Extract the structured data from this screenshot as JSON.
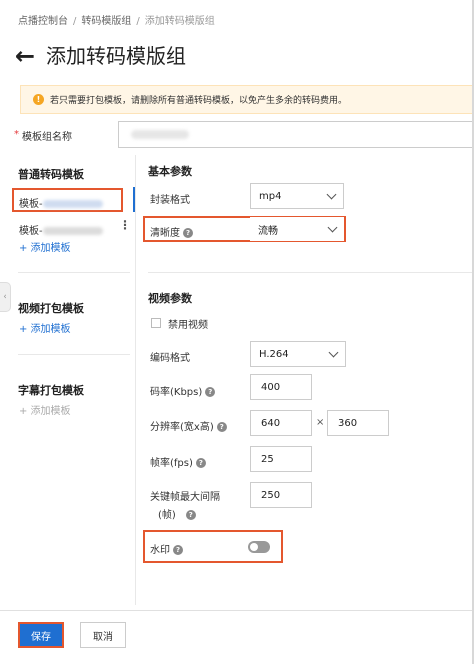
{
  "breadcrumb": [
    "点播控制台",
    "转码模版组",
    "添加转码模版组"
  ],
  "page_title": "添加转码模版组",
  "notice": "若只需要打包模板，请删除所有普通转码模板，以免产生多余的转码费用。",
  "name_field": {
    "label": "模板组名称",
    "value": ""
  },
  "left": {
    "normal_section": "普通转码模板",
    "item1_prefix": "模板-",
    "item2_prefix": "模板-",
    "add_label": "+ 添加模板",
    "video_pack_section": "视频打包模板",
    "video_add_label": "+ 添加模板",
    "subtitle_section": "字幕打包模板",
    "subtitle_add_label": "+ 添加模板"
  },
  "basic": {
    "title": "基本参数",
    "container_label": "封装格式",
    "container_value": "mp4",
    "quality_label": "清晰度",
    "quality_value": "流畅"
  },
  "video": {
    "title": "视频参数",
    "disable_label": "禁用视频",
    "codec_label": "编码格式",
    "codec_value": "H.264",
    "bitrate_label": "码率(Kbps)",
    "bitrate_value": "400",
    "resolution_label": "分辨率(宽x高)",
    "width_value": "640",
    "times": "×",
    "height_value": "360",
    "fps_label": "帧率(fps)",
    "fps_value": "25",
    "gop_label_line1": "关键帧最大间隔",
    "gop_label_line2": "(帧)",
    "gop_value": "250",
    "watermark_label": "水印",
    "watermark_on": false
  },
  "footer": {
    "save": "保存",
    "cancel": "取消"
  },
  "colors": {
    "primary": "#1f6fd1",
    "highlight": "#e4572e",
    "warning": "#f5a623"
  }
}
